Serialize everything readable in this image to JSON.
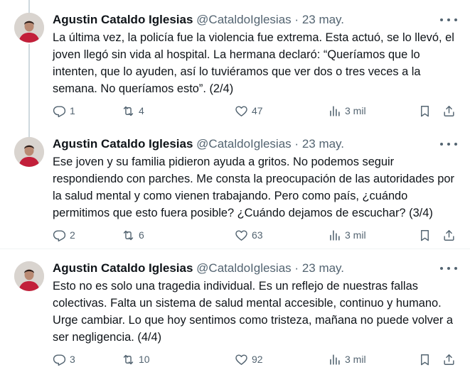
{
  "tweets": [
    {
      "author": "Agustin Cataldo Iglesias",
      "handle": "@CataldoIglesias",
      "sep": "·",
      "date": "23 may.",
      "text": "La última vez, la policía fue la violencia fue extrema. Esta actuó, se lo llevó, el joven llegó sin vida al hospital. La hermana declaró: “Queríamos que lo intenten, que lo ayuden, así lo tuviéramos que ver dos o tres veces a la semana. No queríamos esto”. (2/4)",
      "replies": "1",
      "retweets": "4",
      "likes": "47",
      "views": "3 mil"
    },
    {
      "author": "Agustin Cataldo Iglesias",
      "handle": "@CataldoIglesias",
      "sep": "·",
      "date": "23 may.",
      "text": "Ese joven y su familia pidieron ayuda a gritos. No podemos seguir respondiendo con parches. Me consta la preocupación de las autoridades por la salud mental y como vienen trabajando. Pero como país, ¿cuándo permitimos que esto fuera posible? ¿Cuándo dejamos de escuchar? (3/4)",
      "replies": "2",
      "retweets": "6",
      "likes": "63",
      "views": "3 mil"
    },
    {
      "author": "Agustin Cataldo Iglesias",
      "handle": "@CataldoIglesias",
      "sep": "·",
      "date": "23 may.",
      "text": "Esto no es solo una tragedia individual. Es un reflejo de nuestras fallas colectivas. Falta un sistema de salud mental accesible, continuo y humano. Urge cambiar. Lo que hoy sentimos como tristeza, mañana no puede volver a ser negligencia. (4/4)",
      "replies": "3",
      "retweets": "10",
      "likes": "92",
      "views": "3 mil"
    }
  ],
  "icons": {
    "more": "more-horizontal-icon",
    "reply": "reply-icon",
    "retweet": "retweet-icon",
    "like": "heart-icon",
    "views": "views-bar-chart-icon",
    "bookmark": "bookmark-icon",
    "share": "share-icon"
  },
  "colors": {
    "text": "#0f1419",
    "secondary": "#536471",
    "thread_line": "#cfd9de",
    "divider": "#eff3f4"
  }
}
